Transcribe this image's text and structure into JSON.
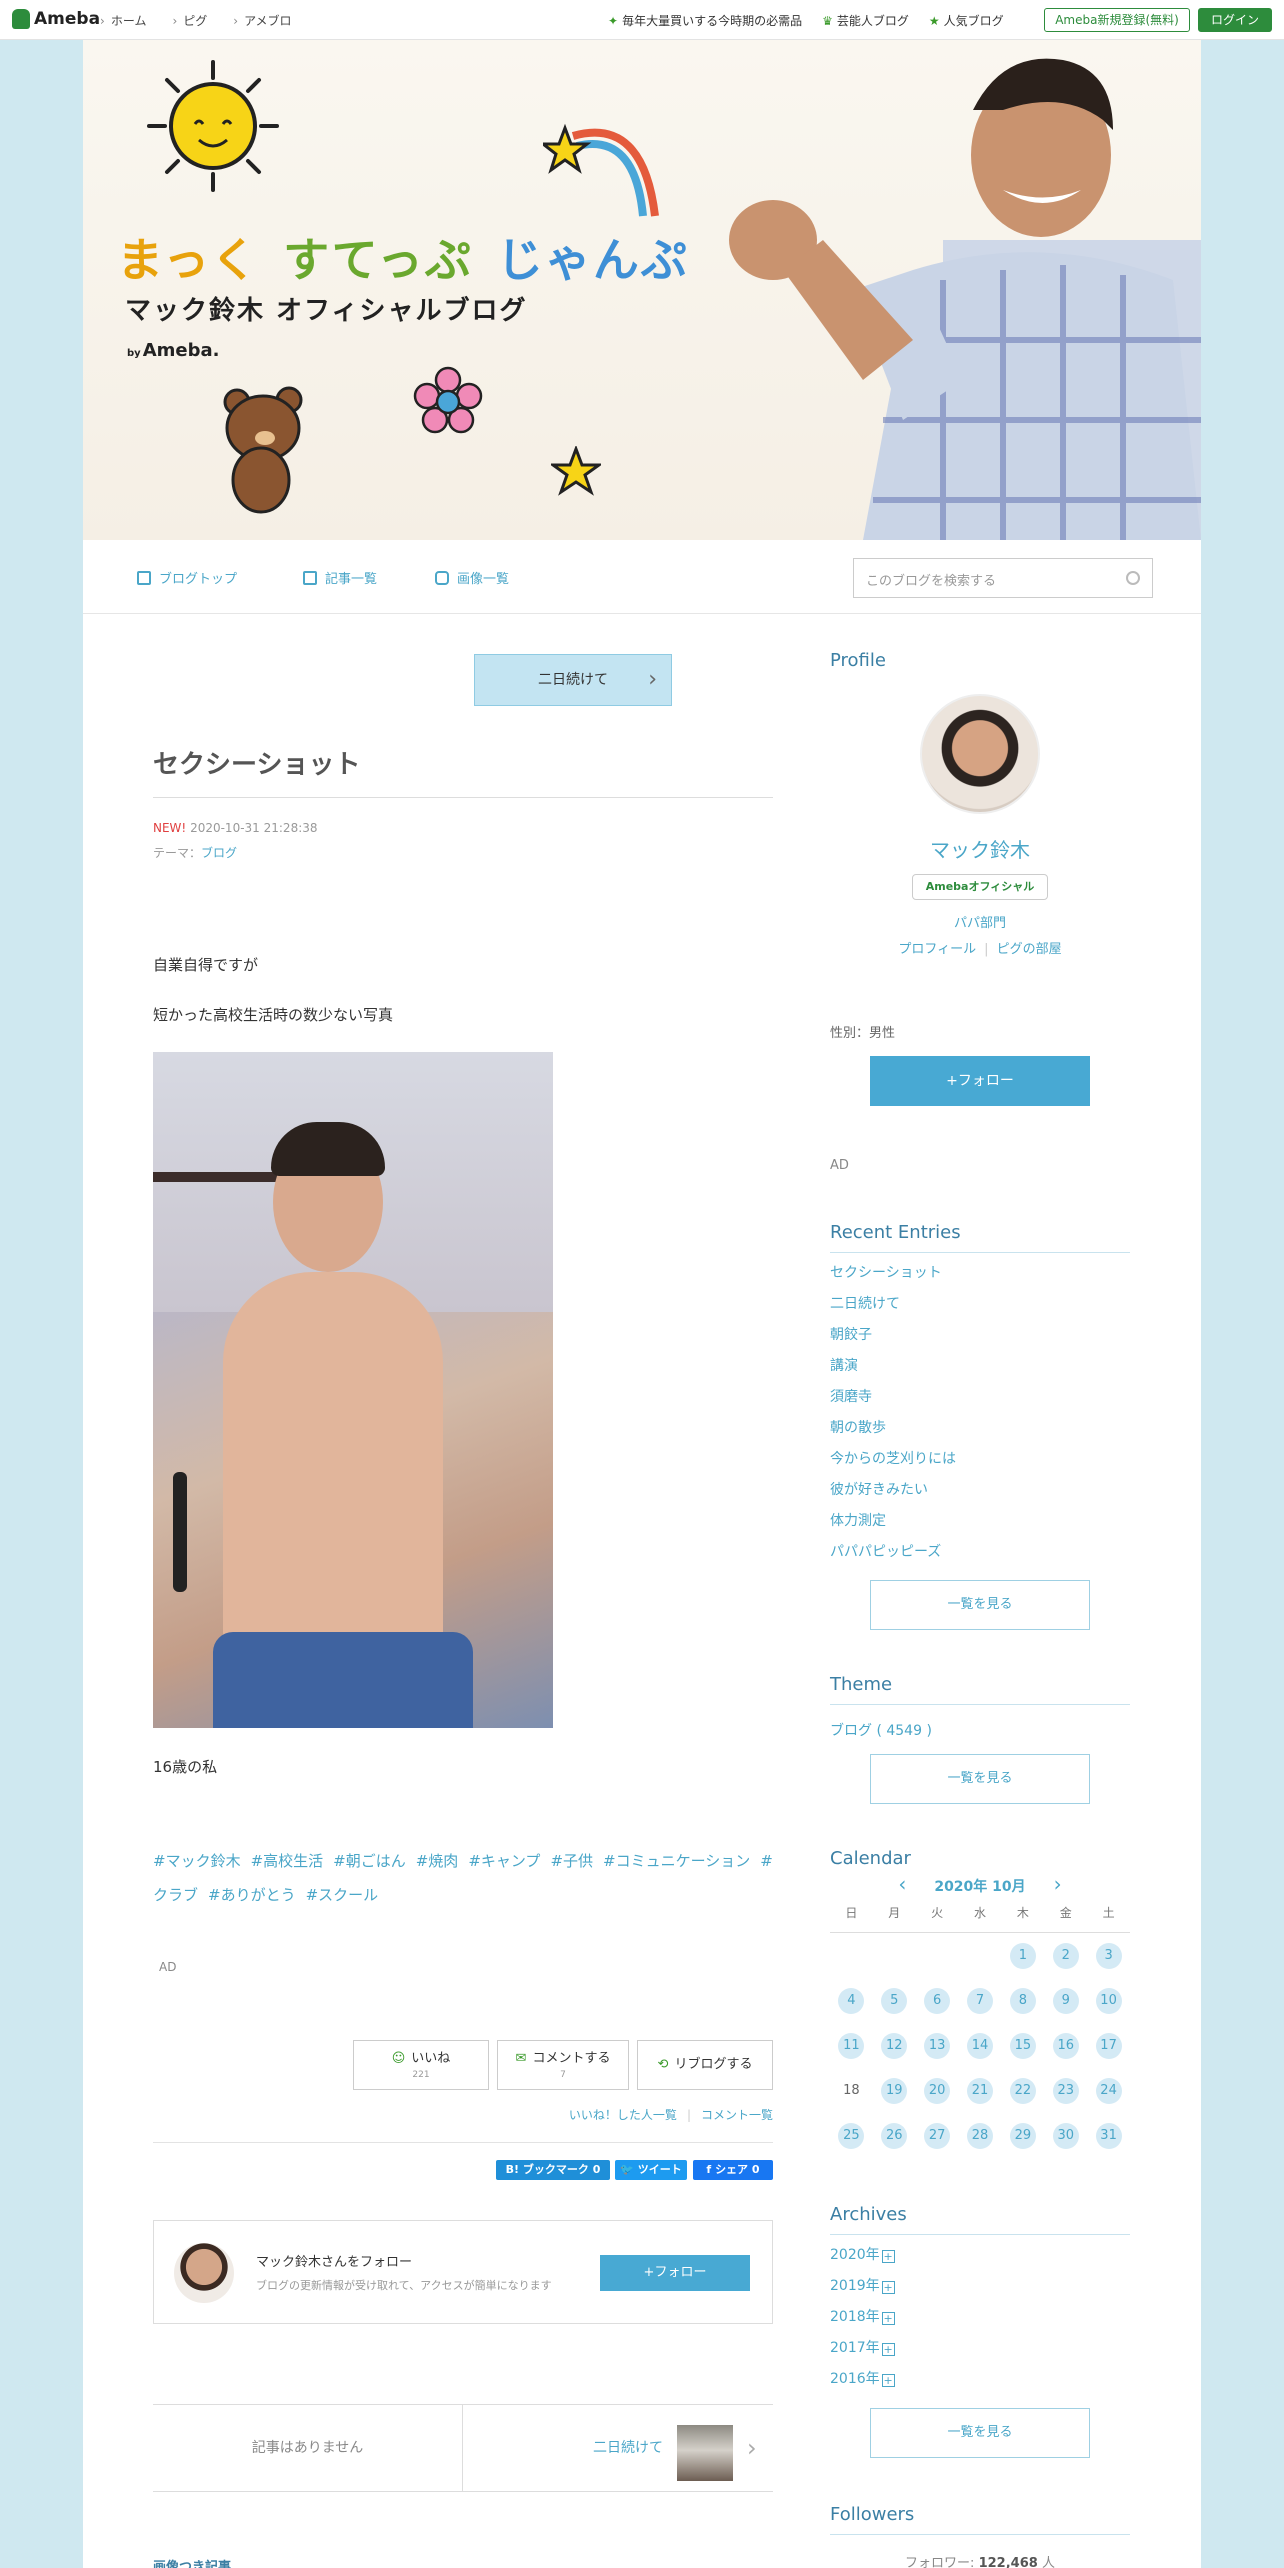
{
  "topbar": {
    "logo": "Ameba",
    "nav_left": [
      "ホーム",
      "ピグ",
      "アメブロ"
    ],
    "nav_right": [
      "毎年大量買いする今時期の必需品",
      "芸能人ブログ",
      "人気ブログ"
    ],
    "register": "Ameba新規登録(無料)",
    "login": "ログイン"
  },
  "header": {
    "title_1": "まっく",
    "title_2": "すてっぷ",
    "title_3": "じゃんぷ",
    "subtitle": "マック鈴木 オフィシャルブログ",
    "by": "by",
    "brand": "Ameba."
  },
  "blognav": {
    "items": [
      "ブログトップ",
      "記事一覧",
      "画像一覧"
    ],
    "search_placeholder": "このブログを検索する"
  },
  "article": {
    "prev_button": "二日続けて",
    "title": "セクシーショット",
    "new_label": "NEW!",
    "datetime": "2020-10-31 21:28:38",
    "theme_label": "テーマ：",
    "theme": "ブログ",
    "p1": "自業自得ですが",
    "p2": "短かった高校生活時の数少ない写真",
    "p3": "16歳の私",
    "tags": [
      "#マック鈴木",
      "#高校生活",
      "#朝ごはん",
      "#焼肉",
      "#キャンプ",
      "#子供",
      "#コミュニケーション",
      "#クラブ",
      "#ありがとう",
      "#スクール"
    ],
    "ad": "AD",
    "like": "いいね",
    "like_count": "221",
    "comment": "コメントする",
    "comment_count": "7",
    "reblog": "リブログする",
    "liked_users": "いいね！した人一覧",
    "comments_list": "コメント一覧",
    "hatena": "B! ブックマーク",
    "hatena_count": "0",
    "tweet": "ツイート",
    "fb_share": "シェア",
    "fb_count": "0",
    "follow_title": "マック鈴木さんをフォロー",
    "follow_desc": "ブログの更新情報が受け取れて、アクセスが簡単になります",
    "follow_btn": "+フォロー",
    "no_article": "記事はありません",
    "next_article": "二日続けて",
    "image_articles": "画像つき記事"
  },
  "sidebar": {
    "profile_h": "Profile",
    "name": "マック鈴木",
    "badge": "Amebaオフィシャル",
    "category": "パパ部門",
    "profile_link": "プロフィール",
    "pig_link": "ピグの部屋",
    "sex": "性別：男性",
    "follow_btn": "+フォロー",
    "ad": "AD",
    "recent_h": "Recent Entries",
    "entries": [
      "セクシーショット",
      "二日続けて",
      "朝餃子",
      "講演",
      "須磨寺",
      "朝の散歩",
      "今からの芝刈りには",
      "彼が好きみたい",
      "体力測定",
      "パパパピッピーズ"
    ],
    "more": "一覧を見る",
    "theme_h": "Theme",
    "theme_link": "ブログ ( 4549 )",
    "calendar_h": "Calendar",
    "cal_month": "2020年 10月",
    "cal_dow": [
      "日",
      "月",
      "火",
      "水",
      "木",
      "金",
      "土"
    ],
    "cal_weeks": [
      [
        "",
        "",
        "",
        "",
        "1",
        "2",
        "3"
      ],
      [
        "4",
        "5",
        "6",
        "7",
        "8",
        "9",
        "10"
      ],
      [
        "11",
        "12",
        "13",
        "14",
        "15",
        "16",
        "17"
      ],
      [
        "18",
        "19",
        "20",
        "21",
        "22",
        "23",
        "24"
      ],
      [
        "25",
        "26",
        "27",
        "28",
        "29",
        "30",
        "31"
      ]
    ],
    "archives_h": "Archives",
    "archives": [
      "2020年",
      "2019年",
      "2018年",
      "2017年",
      "2016年"
    ],
    "followers_h": "Followers",
    "followers_label": "フォロワー:",
    "followers_count": "122,468",
    "followers_unit": "人"
  }
}
